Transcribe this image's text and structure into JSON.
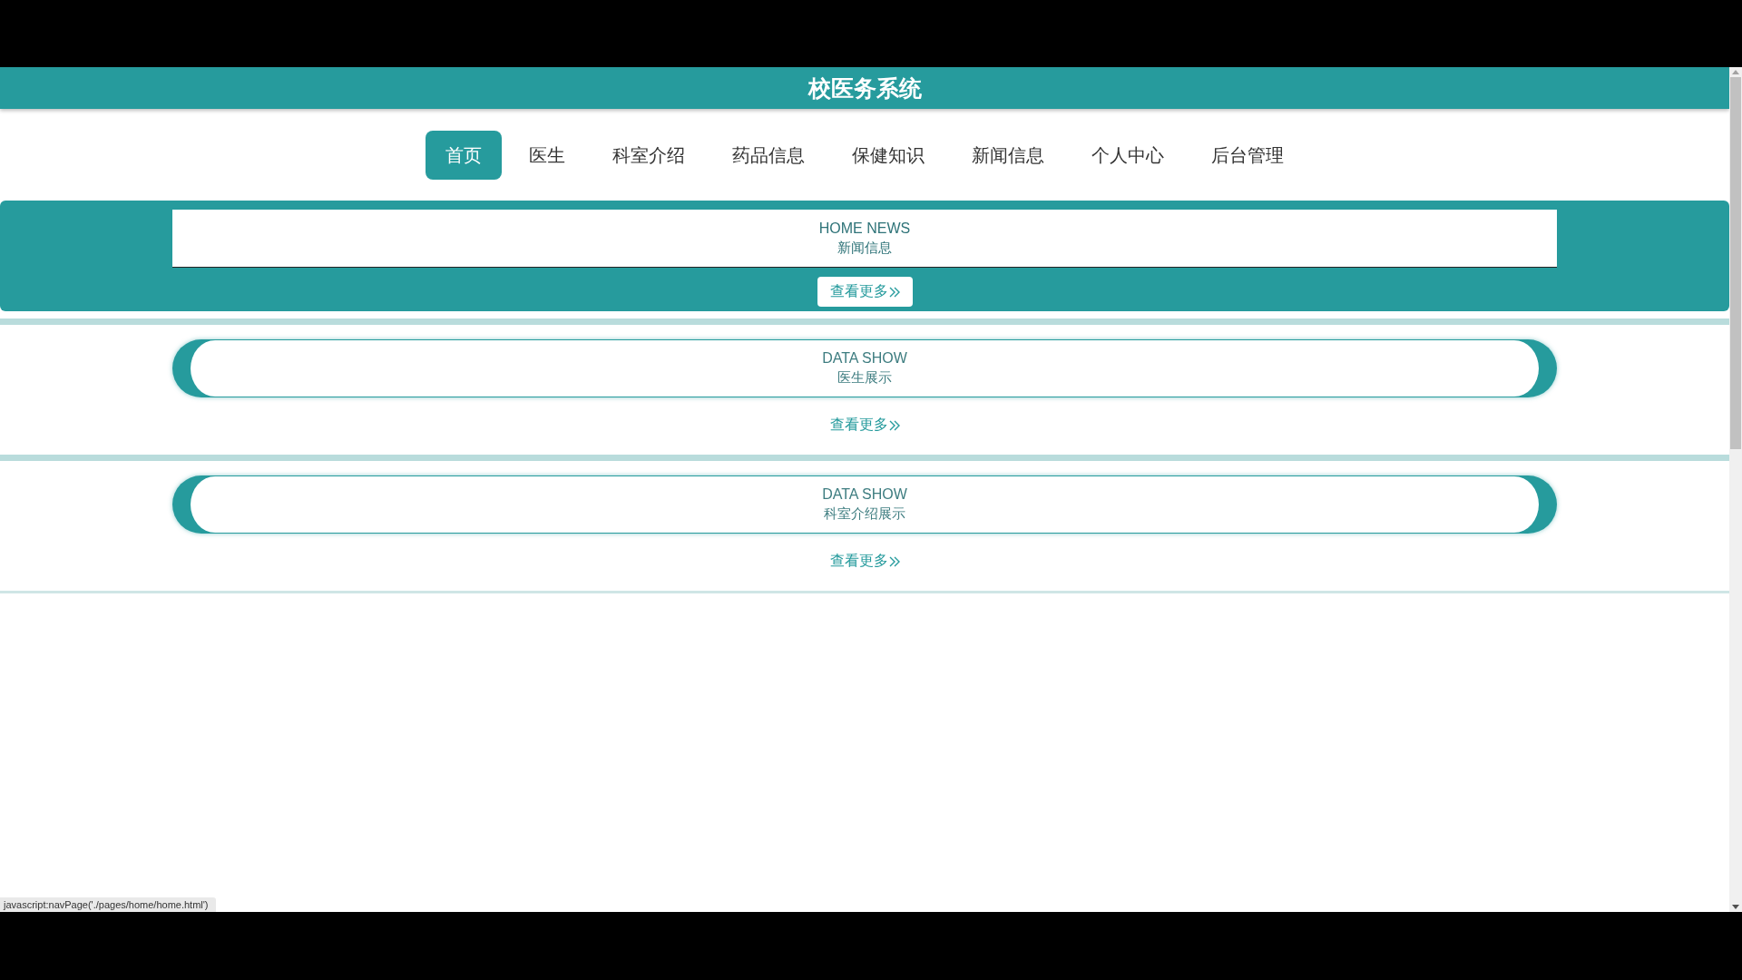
{
  "header": {
    "title": "校医务系统"
  },
  "nav": [
    {
      "label": "首页",
      "selected": true
    },
    {
      "label": "医生",
      "selected": false
    },
    {
      "label": "科室介绍",
      "selected": false
    },
    {
      "label": "药品信息",
      "selected": false
    },
    {
      "label": "保健知识",
      "selected": false
    },
    {
      "label": "新闻信息",
      "selected": false
    },
    {
      "label": "个人中心",
      "selected": false
    },
    {
      "label": "后台管理",
      "selected": false
    }
  ],
  "news": {
    "title_en": "HOME NEWS",
    "title": "新闻信息",
    "more": "查看更多"
  },
  "sections": [
    {
      "title_en": "DATA SHOW",
      "title": "医生展示",
      "more": "查看更多"
    },
    {
      "title_en": "DATA SHOW",
      "title": "科室介绍展示",
      "more": "查看更多"
    }
  ],
  "status_bar": {
    "text": "javascript:navPage('./pages/home/home.html')"
  }
}
